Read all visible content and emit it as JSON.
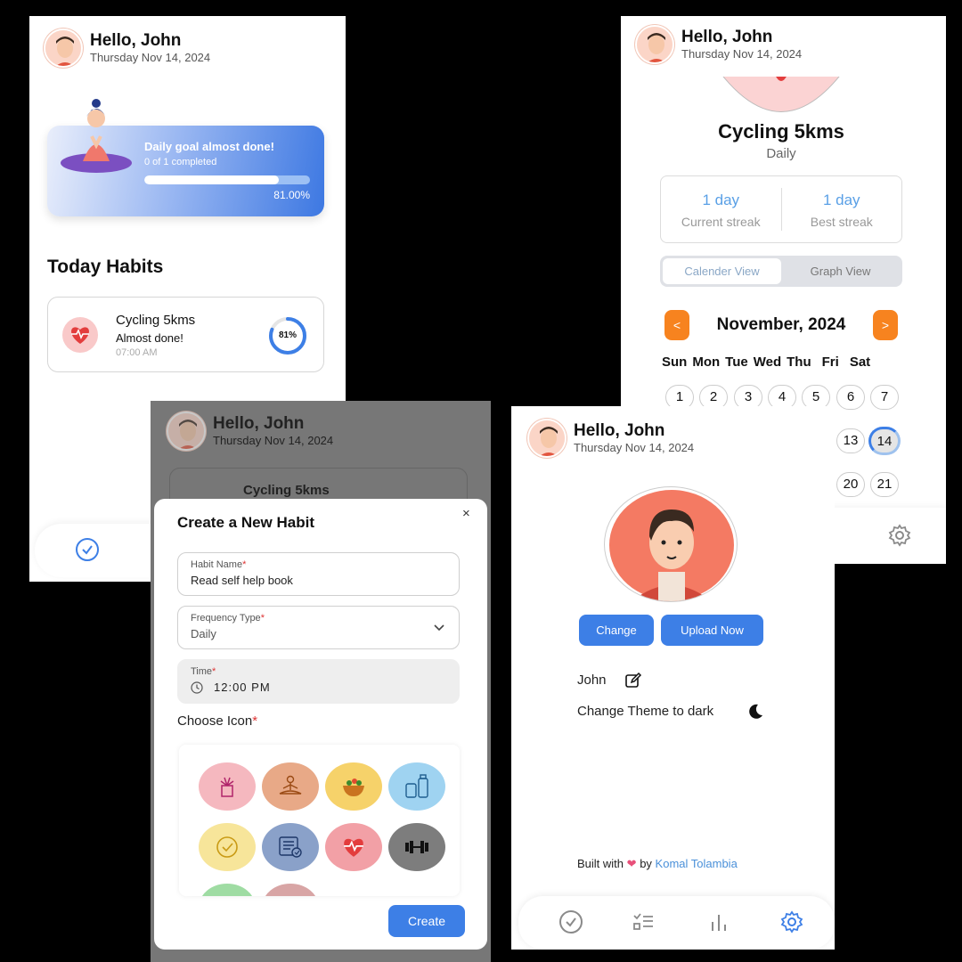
{
  "user": {
    "greeting": "Hello, John",
    "date": "Thursday Nov 14, 2024"
  },
  "home": {
    "goal_title": "Daily goal almost done!",
    "goal_sub": "0 of 1 completed",
    "goal_progress": 0.81,
    "goal_pct": "81.00%",
    "section_title": "Today Habits",
    "habit": {
      "name": "Cycling 5kms",
      "status": "Almost done!",
      "time": "07:00 AM",
      "pct_label": "81%",
      "progress": 0.81
    }
  },
  "detail": {
    "title": "Cycling 5kms",
    "frequency": "Daily",
    "current_streak_val": "1 day",
    "current_streak_lbl": "Current streak",
    "best_streak_val": "1 day",
    "best_streak_lbl": "Best streak",
    "tab_calendar": "Calender View",
    "tab_graph": "Graph View",
    "prev": "<",
    "next": ">",
    "month": "November, 2024",
    "weekdays": [
      "Sun",
      "Mon",
      "Tue",
      "Wed",
      "Thu",
      "Fri",
      "Sat"
    ],
    "days_row1": [
      "1",
      "2",
      "3",
      "4",
      "5",
      "6",
      "7"
    ],
    "days_row2": [
      "13",
      "14"
    ],
    "days_row3": [
      "20",
      "21"
    ],
    "selected_day": "14"
  },
  "modal": {
    "title": "Create a New Habit",
    "close": "×",
    "bg_habit": "Cycling 5kms",
    "habit_name_label": "Habit Name",
    "habit_name_value": "Read self help book",
    "freq_label": "Frequency Type",
    "freq_value": "Daily",
    "time_label": "Time",
    "time_value": "12:00 PM",
    "choose_icon": "Choose Icon",
    "required": "*",
    "create": "Create",
    "icons": [
      "plant-icon",
      "meditation-icon",
      "salad-icon",
      "water-bottle-icon",
      "clock-icon",
      "checklist-icon",
      "heartbeat-icon",
      "dumbbell-icon"
    ],
    "icon_colors": [
      "#f5b8bf",
      "#e8a987",
      "#f6d26a",
      "#9fd3f1",
      "#f7e59a",
      "#8aa1c9",
      "#f2a0a6",
      "#7d7d7d"
    ]
  },
  "profile": {
    "change": "Change",
    "upload": "Upload Now",
    "name": "John",
    "theme": "Change Theme to dark",
    "built_prefix": "Built with",
    "built_by": "by",
    "author": "Komal Tolambia"
  },
  "colors": {
    "accent": "#3d7fe6",
    "orange": "#f7831f",
    "streak": "#5aa0e6"
  }
}
